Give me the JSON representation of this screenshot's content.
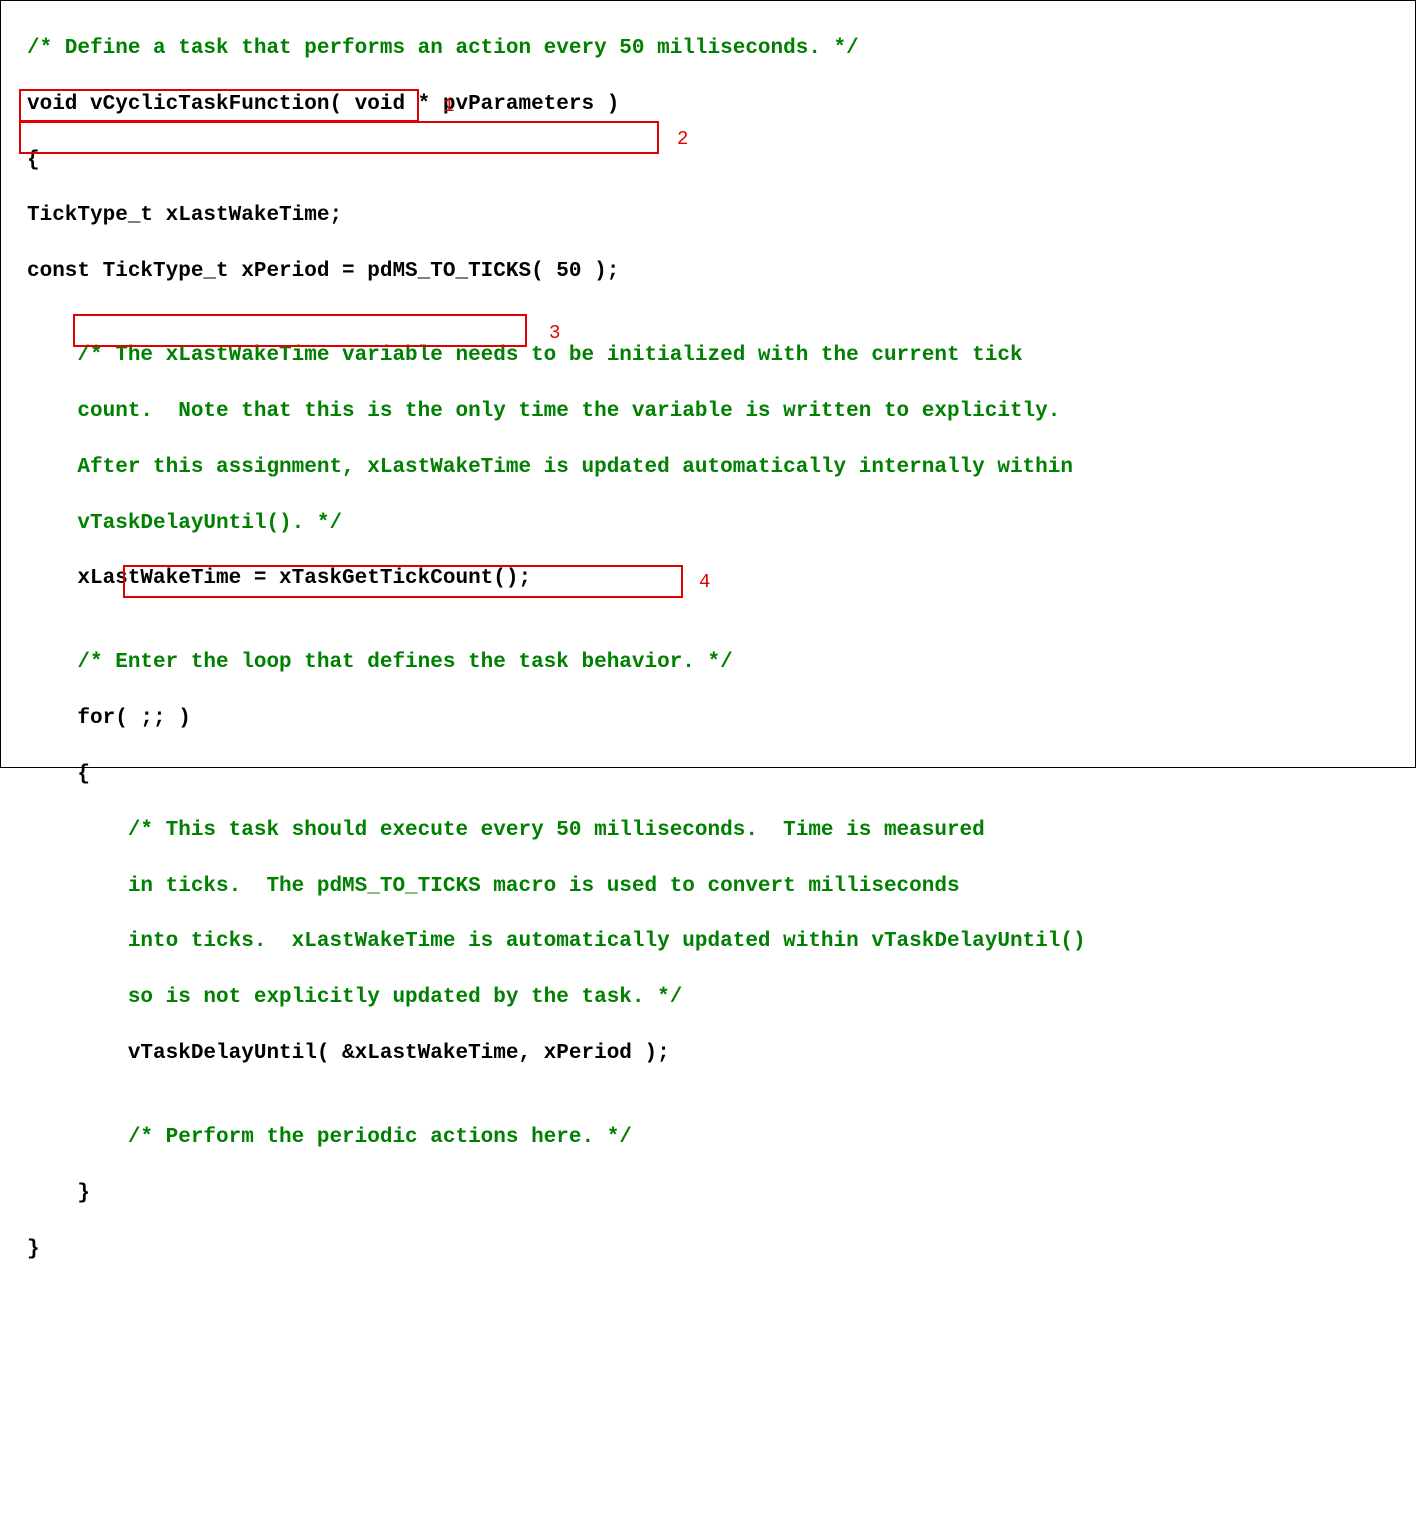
{
  "code": {
    "l01": "/* Define a task that performs an action every 50 milliseconds. */",
    "l02": "void vCyclicTaskFunction( void * pvParameters )",
    "l03": "{",
    "l04": "TickType_t xLastWakeTime;",
    "l05": "const TickType_t xPeriod = pdMS_TO_TICKS( 50 );",
    "l06": "",
    "l07": "    /* The xLastWakeTime variable needs to be initialized with the current tick",
    "l08": "    count.  Note that this is the only time the variable is written to explicitly.",
    "l09": "    After this assignment, xLastWakeTime is updated automatically internally within",
    "l10": "    vTaskDelayUntil(). */",
    "l11": "    xLastWakeTime = xTaskGetTickCount();",
    "l12": "",
    "l13": "    /* Enter the loop that defines the task behavior. */",
    "l14": "    for( ;; )",
    "l15": "    {",
    "l16": "        /* This task should execute every 50 milliseconds.  Time is measured",
    "l17": "        in ticks.  The pdMS_TO_TICKS macro is used to convert milliseconds",
    "l18": "        into ticks.  xLastWakeTime is automatically updated within vTaskDelayUntil()",
    "l19": "        so is not explicitly updated by the task. */",
    "l20": "        vTaskDelayUntil( &xLastWakeTime, xPeriod );",
    "l21": "",
    "l22": "        /* Perform the periodic actions here. */",
    "l23": "    }",
    "l24": "}"
  },
  "annotations": {
    "n1": "1",
    "n2": "2",
    "n3": "3",
    "n4": "4"
  },
  "highlights": {
    "box1": "TickType_t xLastWakeTime;",
    "box2": "const TickType_t xPeriod = pdMS_TO_TICKS( 50 );",
    "box3": "xLastWakeTime = xTaskGetTickCount();",
    "box4": "vTaskDelayUntil( &xLastWakeTime, xPeriod );"
  }
}
